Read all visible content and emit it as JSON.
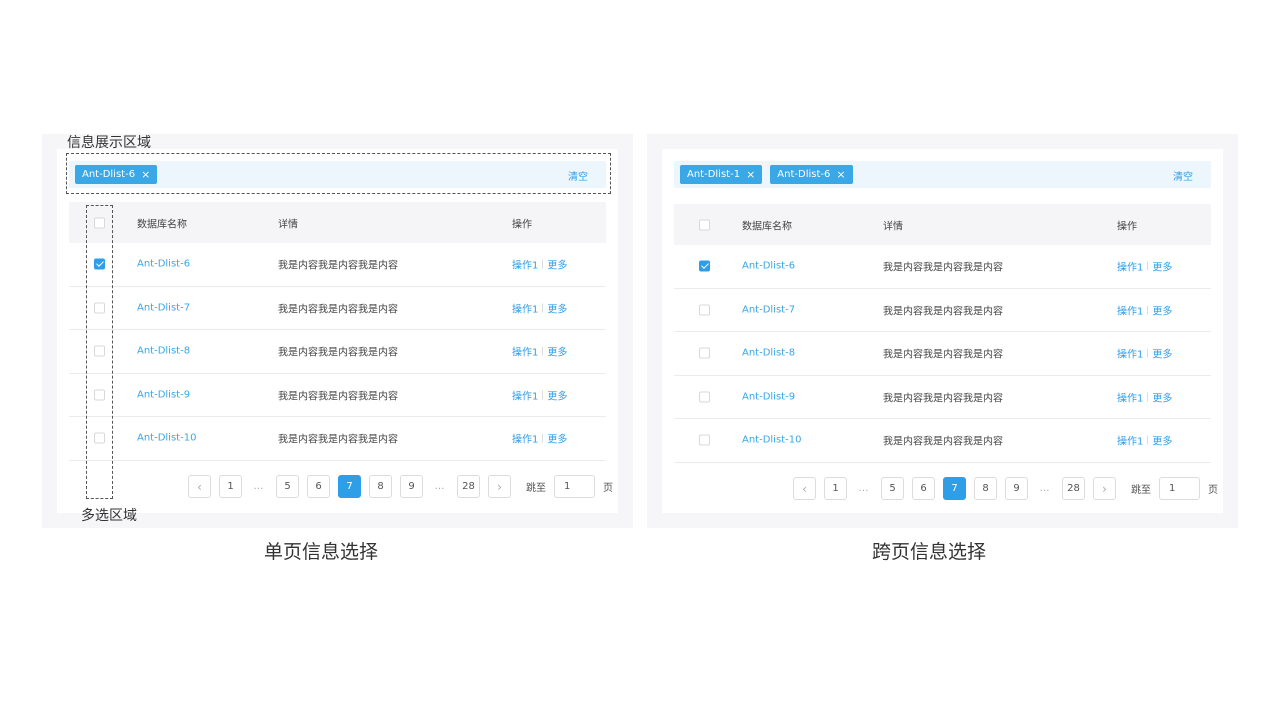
{
  "annotations": {
    "info_area": "信息展示区域",
    "multi_select_area": "多选区域"
  },
  "captions": {
    "left": "单页信息选择",
    "right": "跨页信息选择"
  },
  "table": {
    "headers": {
      "name": "数据库名称",
      "detail": "详情",
      "ops": "操作"
    },
    "rows": [
      {
        "name": "Ant-Dlist-6",
        "detail": "我是内容我是内容我是内容",
        "op1": "操作1",
        "more": "更多"
      },
      {
        "name": "Ant-Dlist-7",
        "detail": "我是内容我是内容我是内容",
        "op1": "操作1",
        "more": "更多"
      },
      {
        "name": "Ant-Dlist-8",
        "detail": "我是内容我是内容我是内容",
        "op1": "操作1",
        "more": "更多"
      },
      {
        "name": "Ant-Dlist-9",
        "detail": "我是内容我是内容我是内容",
        "op1": "操作1",
        "more": "更多"
      },
      {
        "name": "Ant-Dlist-10",
        "detail": "我是内容我是内容我是内容",
        "op1": "操作1",
        "more": "更多"
      }
    ]
  },
  "left_panel": {
    "chips": [
      "Ant-Dlist-6"
    ],
    "clear_label": "清空",
    "checked_rows": [
      true,
      false,
      false,
      false,
      false
    ]
  },
  "right_panel": {
    "chips": [
      "Ant-Dlist-1",
      "Ant-Dlist-6"
    ],
    "clear_label": "清空",
    "checked_rows": [
      true,
      false,
      false,
      false,
      false
    ]
  },
  "pagination": {
    "prev": "‹",
    "next": "›",
    "pages": [
      "1",
      "…",
      "5",
      "6",
      "7",
      "8",
      "9",
      "…",
      "28"
    ],
    "current": "7",
    "jump_label": "跳至",
    "jump_value": "1",
    "page_unit": "页"
  },
  "icons": {
    "chip_close": "close-icon",
    "checkbox_checked": "check-icon"
  },
  "colors": {
    "primary": "#2f9ee8",
    "chip_bg": "#3aa7e6",
    "chipbar_bg": "#edf6fd",
    "header_bg": "#f5f5f7"
  }
}
